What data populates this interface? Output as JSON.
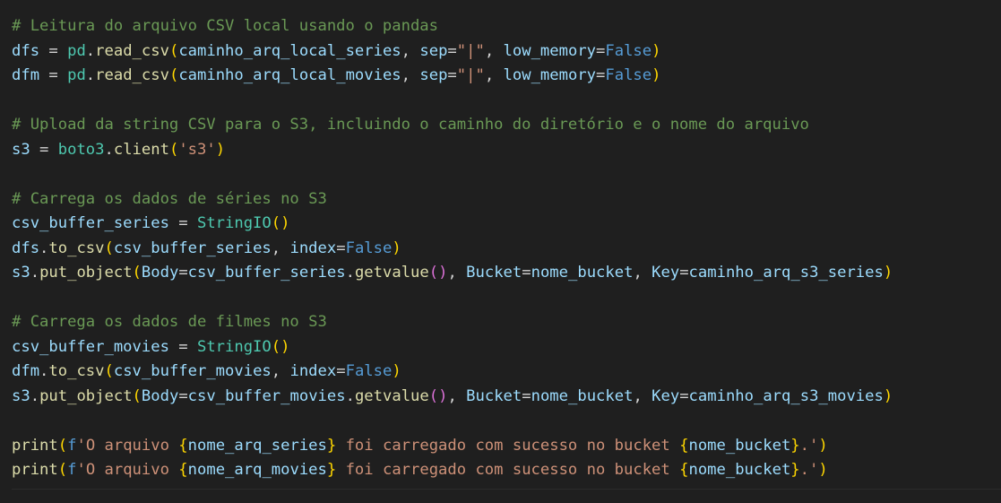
{
  "colors": {
    "background": "#1f1f1f",
    "comment": "#6a9955",
    "variable": "#9cdcfe",
    "operator": "#d4d4d4",
    "function": "#dcdcaa",
    "class": "#4ec9b0",
    "string": "#ce9178",
    "keyword": "#569cd6",
    "bracket1": "#ffd700",
    "bracket2": "#da70d6",
    "bracket3": "#179fff"
  },
  "code_lines": [
    [
      {
        "t": "# Leitura do arquivo CSV local usando o pandas",
        "c": "comment"
      }
    ],
    [
      {
        "t": "dfs",
        "c": "variable"
      },
      {
        "t": " = ",
        "c": "operator"
      },
      {
        "t": "pd",
        "c": "class"
      },
      {
        "t": ".",
        "c": "operator"
      },
      {
        "t": "read_csv",
        "c": "function"
      },
      {
        "t": "(",
        "c": "bracket1"
      },
      {
        "t": "caminho_arq_local_series",
        "c": "variable"
      },
      {
        "t": ", ",
        "c": "operator"
      },
      {
        "t": "sep",
        "c": "variable"
      },
      {
        "t": "=",
        "c": "operator"
      },
      {
        "t": "\"|\"",
        "c": "string"
      },
      {
        "t": ", ",
        "c": "operator"
      },
      {
        "t": "low_memory",
        "c": "variable"
      },
      {
        "t": "=",
        "c": "operator"
      },
      {
        "t": "False",
        "c": "keyword"
      },
      {
        "t": ")",
        "c": "bracket1"
      }
    ],
    [
      {
        "t": "dfm",
        "c": "variable"
      },
      {
        "t": " = ",
        "c": "operator"
      },
      {
        "t": "pd",
        "c": "class"
      },
      {
        "t": ".",
        "c": "operator"
      },
      {
        "t": "read_csv",
        "c": "function"
      },
      {
        "t": "(",
        "c": "bracket1"
      },
      {
        "t": "caminho_arq_local_movies",
        "c": "variable"
      },
      {
        "t": ", ",
        "c": "operator"
      },
      {
        "t": "sep",
        "c": "variable"
      },
      {
        "t": "=",
        "c": "operator"
      },
      {
        "t": "\"|\"",
        "c": "string"
      },
      {
        "t": ", ",
        "c": "operator"
      },
      {
        "t": "low_memory",
        "c": "variable"
      },
      {
        "t": "=",
        "c": "operator"
      },
      {
        "t": "False",
        "c": "keyword"
      },
      {
        "t": ")",
        "c": "bracket1"
      }
    ],
    [],
    [
      {
        "t": "# Upload da string CSV para o S3, incluindo o caminho do diretório e o nome do arquivo",
        "c": "comment"
      }
    ],
    [
      {
        "t": "s3",
        "c": "variable"
      },
      {
        "t": " = ",
        "c": "operator"
      },
      {
        "t": "boto3",
        "c": "class"
      },
      {
        "t": ".",
        "c": "operator"
      },
      {
        "t": "client",
        "c": "function"
      },
      {
        "t": "(",
        "c": "bracket1"
      },
      {
        "t": "'s3'",
        "c": "string"
      },
      {
        "t": ")",
        "c": "bracket1"
      }
    ],
    [],
    [
      {
        "t": "# Carrega os dados de séries no S3",
        "c": "comment"
      }
    ],
    [
      {
        "t": "csv_buffer_series",
        "c": "variable"
      },
      {
        "t": " = ",
        "c": "operator"
      },
      {
        "t": "StringIO",
        "c": "class"
      },
      {
        "t": "()",
        "c": "bracket1"
      }
    ],
    [
      {
        "t": "dfs",
        "c": "variable"
      },
      {
        "t": ".",
        "c": "operator"
      },
      {
        "t": "to_csv",
        "c": "function"
      },
      {
        "t": "(",
        "c": "bracket1"
      },
      {
        "t": "csv_buffer_series",
        "c": "variable"
      },
      {
        "t": ", ",
        "c": "operator"
      },
      {
        "t": "index",
        "c": "variable"
      },
      {
        "t": "=",
        "c": "operator"
      },
      {
        "t": "False",
        "c": "keyword"
      },
      {
        "t": ")",
        "c": "bracket1"
      }
    ],
    [
      {
        "t": "s3",
        "c": "variable"
      },
      {
        "t": ".",
        "c": "operator"
      },
      {
        "t": "put_object",
        "c": "function"
      },
      {
        "t": "(",
        "c": "bracket1"
      },
      {
        "t": "Body",
        "c": "variable"
      },
      {
        "t": "=",
        "c": "operator"
      },
      {
        "t": "csv_buffer_series",
        "c": "variable"
      },
      {
        "t": ".",
        "c": "operator"
      },
      {
        "t": "getvalue",
        "c": "function"
      },
      {
        "t": "()",
        "c": "bracket2"
      },
      {
        "t": ", ",
        "c": "operator"
      },
      {
        "t": "Bucket",
        "c": "variable"
      },
      {
        "t": "=",
        "c": "operator"
      },
      {
        "t": "nome_bucket",
        "c": "variable"
      },
      {
        "t": ", ",
        "c": "operator"
      },
      {
        "t": "Key",
        "c": "variable"
      },
      {
        "t": "=",
        "c": "operator"
      },
      {
        "t": "caminho_arq_s3_series",
        "c": "variable"
      },
      {
        "t": ")",
        "c": "bracket1"
      }
    ],
    [],
    [
      {
        "t": "# Carrega os dados de filmes no S3",
        "c": "comment"
      }
    ],
    [
      {
        "t": "csv_buffer_movies",
        "c": "variable"
      },
      {
        "t": " = ",
        "c": "operator"
      },
      {
        "t": "StringIO",
        "c": "class"
      },
      {
        "t": "()",
        "c": "bracket1"
      }
    ],
    [
      {
        "t": "dfm",
        "c": "variable"
      },
      {
        "t": ".",
        "c": "operator"
      },
      {
        "t": "to_csv",
        "c": "function"
      },
      {
        "t": "(",
        "c": "bracket1"
      },
      {
        "t": "csv_buffer_movies",
        "c": "variable"
      },
      {
        "t": ", ",
        "c": "operator"
      },
      {
        "t": "index",
        "c": "variable"
      },
      {
        "t": "=",
        "c": "operator"
      },
      {
        "t": "False",
        "c": "keyword"
      },
      {
        "t": ")",
        "c": "bracket1"
      }
    ],
    [
      {
        "t": "s3",
        "c": "variable"
      },
      {
        "t": ".",
        "c": "operator"
      },
      {
        "t": "put_object",
        "c": "function"
      },
      {
        "t": "(",
        "c": "bracket1"
      },
      {
        "t": "Body",
        "c": "variable"
      },
      {
        "t": "=",
        "c": "operator"
      },
      {
        "t": "csv_buffer_movies",
        "c": "variable"
      },
      {
        "t": ".",
        "c": "operator"
      },
      {
        "t": "getvalue",
        "c": "function"
      },
      {
        "t": "()",
        "c": "bracket2"
      },
      {
        "t": ", ",
        "c": "operator"
      },
      {
        "t": "Bucket",
        "c": "variable"
      },
      {
        "t": "=",
        "c": "operator"
      },
      {
        "t": "nome_bucket",
        "c": "variable"
      },
      {
        "t": ", ",
        "c": "operator"
      },
      {
        "t": "Key",
        "c": "variable"
      },
      {
        "t": "=",
        "c": "operator"
      },
      {
        "t": "caminho_arq_s3_movies",
        "c": "variable"
      },
      {
        "t": ")",
        "c": "bracket1"
      }
    ],
    [],
    [
      {
        "t": "print",
        "c": "function"
      },
      {
        "t": "(",
        "c": "bracket1"
      },
      {
        "t": "f",
        "c": "keyword"
      },
      {
        "t": "'O arquivo ",
        "c": "string"
      },
      {
        "t": "{",
        "c": "bracket1"
      },
      {
        "t": "nome_arq_series",
        "c": "variable"
      },
      {
        "t": "}",
        "c": "bracket1"
      },
      {
        "t": " foi carregado com sucesso no bucket ",
        "c": "string"
      },
      {
        "t": "{",
        "c": "bracket1"
      },
      {
        "t": "nome_bucket",
        "c": "variable"
      },
      {
        "t": "}",
        "c": "bracket1"
      },
      {
        "t": ".'",
        "c": "string"
      },
      {
        "t": ")",
        "c": "bracket1"
      }
    ],
    [
      {
        "t": "print",
        "c": "function"
      },
      {
        "t": "(",
        "c": "bracket1"
      },
      {
        "t": "f",
        "c": "keyword"
      },
      {
        "t": "'O arquivo ",
        "c": "string"
      },
      {
        "t": "{",
        "c": "bracket1"
      },
      {
        "t": "nome_arq_movies",
        "c": "variable"
      },
      {
        "t": "}",
        "c": "bracket1"
      },
      {
        "t": " foi carregado com sucesso no bucket ",
        "c": "string"
      },
      {
        "t": "{",
        "c": "bracket1"
      },
      {
        "t": "nome_bucket",
        "c": "variable"
      },
      {
        "t": "}",
        "c": "bracket1"
      },
      {
        "t": ".'",
        "c": "string"
      },
      {
        "t": ")",
        "c": "bracket1"
      }
    ]
  ]
}
